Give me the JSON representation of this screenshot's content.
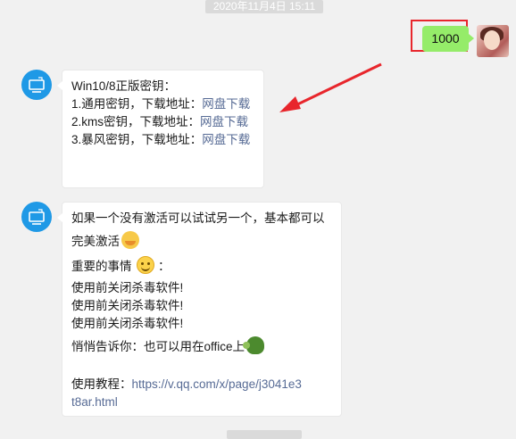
{
  "timestamp_top": "2020年11月4日 15:11",
  "outgoing": {
    "text": "1000"
  },
  "msg1": {
    "title": "Win10/8正版密钥：",
    "items": [
      {
        "label": "1.通用密钥，下载地址：",
        "link": "网盘下载"
      },
      {
        "label": "2.kms密钥，下载地址：",
        "link": "网盘下载"
      },
      {
        "label": "3.暴风密钥，下载地址：",
        "link": "网盘下载"
      }
    ]
  },
  "msg2": {
    "line1": "如果一个没有激活可以试试另一个，基本都可以",
    "line2": "完美激活",
    "line3": "重要的事情",
    "line3_suffix": "：",
    "warn1": "使用前关闭杀毒软件!",
    "warn2": "使用前关闭杀毒软件!",
    "warn3": "使用前关闭杀毒软件!",
    "tip": "悄悄告诉你：也可以用在office上",
    "tutorial_label": "使用教程：",
    "tutorial_url_1": "https://v.qq.com/x/page/j3041e3",
    "tutorial_url_2": "t8ar.html"
  },
  "colors": {
    "background": "#f1f1f1",
    "outgoing_bubble": "#95ec69",
    "link": "#576b95",
    "highlight": "#e8262c",
    "bot_avatar": "#1f99e6"
  }
}
